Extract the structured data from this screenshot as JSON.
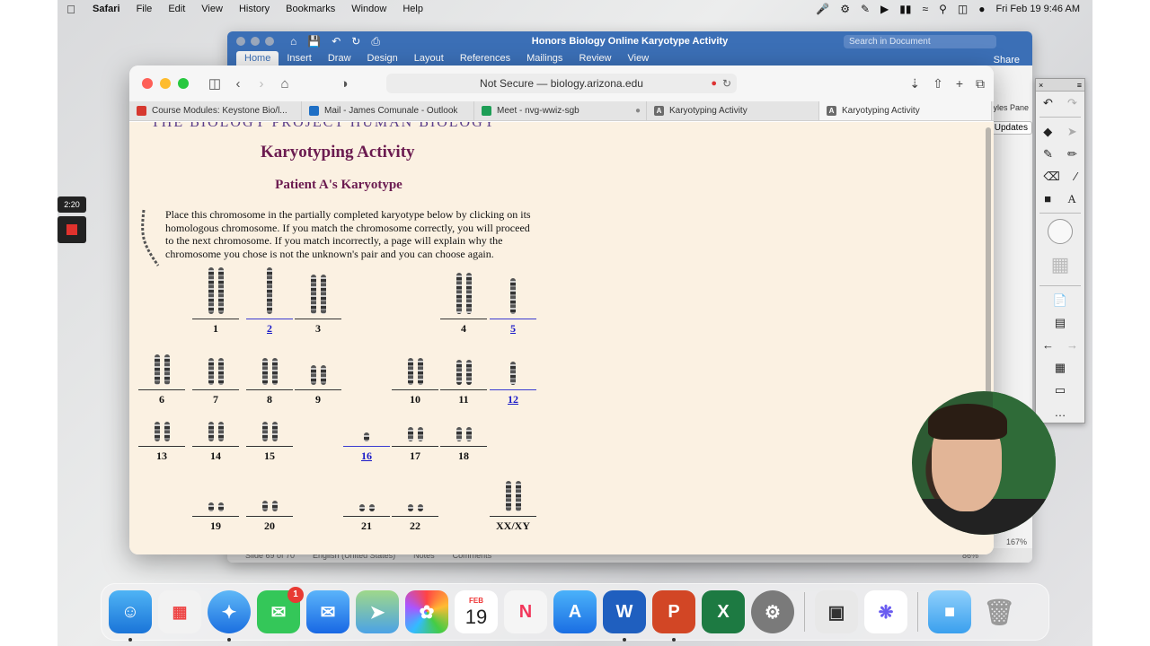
{
  "menubar": {
    "app": "Safari",
    "items": [
      "File",
      "Edit",
      "View",
      "History",
      "Bookmarks",
      "Window",
      "Help"
    ],
    "clock": "Fri Feb 19  9:46 AM"
  },
  "word": {
    "title": "Honors Biology Online Karyotype Activity",
    "search_placeholder": "Search in Document",
    "tabs": [
      "Home",
      "Insert",
      "Draw",
      "Design",
      "Layout",
      "References",
      "Mailings",
      "Review",
      "View"
    ],
    "share": "Share",
    "styles_pane": "Styles Pane",
    "updates": "Updates",
    "status_slide": "Slide 69 of 70",
    "status_lang": "English (United States)",
    "status_notes": "Notes",
    "status_comments": "Comments",
    "zoom": "167%",
    "zoom_small": "86%"
  },
  "safari": {
    "address": "Not Secure — biology.arizona.edu",
    "tabs": [
      {
        "label": "Course Modules: Keystone Bio/l...",
        "color": "#d6382f"
      },
      {
        "label": "Mail - James Comunale - Outlook",
        "color": "#1f6fc5"
      },
      {
        "label": "Meet - nvg-wwiz-sgb",
        "color": "#1e9e56"
      },
      {
        "label": "Karyotyping Activity",
        "color": "#6b6b6b"
      },
      {
        "label": "Karyotyping Activity",
        "color": "#6b6b6b"
      }
    ]
  },
  "page": {
    "cut_heading": "THE BIOLOGY PROJECT   HUMAN BIOLOGY",
    "title": "Karyotyping Activity",
    "subtitle": "Patient A's Karyotype",
    "instructions": "Place this chromosome in the partially completed karyotype below by clicking on its homologous chromosome. If you match the chromosome correctly, you will proceed to the next chromosome. If you match incorrectly, a page will explain why the chromosome you chose is not the unknown's pair and you can choose again.",
    "slots": [
      {
        "label": "1",
        "link": false
      },
      {
        "label": "2",
        "link": true
      },
      {
        "label": "3",
        "link": false
      },
      {
        "label": "4",
        "link": false
      },
      {
        "label": "5",
        "link": true
      },
      {
        "label": "6",
        "link": false
      },
      {
        "label": "7",
        "link": false
      },
      {
        "label": "8",
        "link": false
      },
      {
        "label": "9",
        "link": false
      },
      {
        "label": "10",
        "link": false
      },
      {
        "label": "11",
        "link": false
      },
      {
        "label": "12",
        "link": true
      },
      {
        "label": "13",
        "link": false
      },
      {
        "label": "14",
        "link": false
      },
      {
        "label": "15",
        "link": false
      },
      {
        "label": "16",
        "link": true
      },
      {
        "label": "17",
        "link": false
      },
      {
        "label": "18",
        "link": false
      },
      {
        "label": "19",
        "link": false
      },
      {
        "label": "20",
        "link": false
      },
      {
        "label": "21",
        "link": false
      },
      {
        "label": "22",
        "link": false
      },
      {
        "label": "XX/XY",
        "link": false
      }
    ]
  },
  "recording": {
    "time": "2:20"
  },
  "dock": {
    "messages_badge": "1",
    "calendar_month": "FEB",
    "calendar_day": "19"
  }
}
